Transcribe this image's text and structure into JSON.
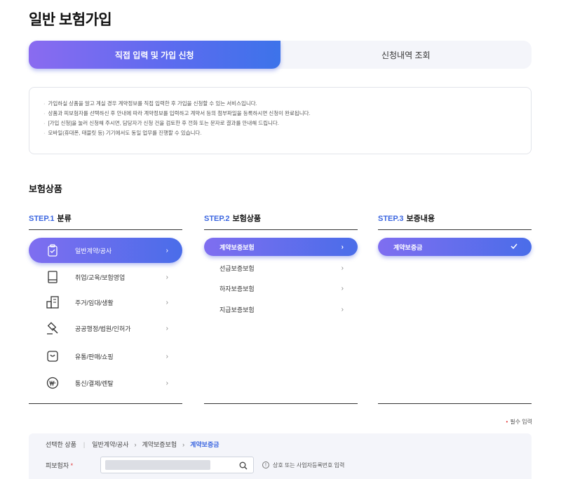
{
  "page": {
    "title": "일반 보험가입"
  },
  "tabs": [
    {
      "label": "직접 입력 및 가입 신청"
    },
    {
      "label": "신청내역 조회"
    }
  ],
  "notice": {
    "lines": [
      "가입하실 상품을 알고 계실 경우 계약정보를 직접 입력한 후 가입을 신청할 수 있는 서비스입니다.",
      "상품과 피보험자를 선택하신 후 안내에 따라 계약정보를 입력하고 계약서 등의 첨부파일을 등록하시면 신청이 완료됩니다.",
      "[가입 신청]을 눌러 신청해 주시면, 담당자가 신청 건을 검토한 후 전화 또는 문자로 결과를 안내해 드립니다.",
      "모바일(휴대폰, 태블릿 등) 기기에서도 동일 업무를 진행할 수 있습니다."
    ]
  },
  "products_section": {
    "title": "보험상품"
  },
  "step1": {
    "num": "STEP.1",
    "title": "분류",
    "items": [
      {
        "label": "일반계약/공사",
        "icon": "clipboard-icon"
      },
      {
        "label": "취업/교육/보험영업",
        "icon": "book-icon"
      },
      {
        "label": "주거/임대/생활",
        "icon": "building-icon"
      },
      {
        "label": "공공행정/법원/인허가",
        "icon": "gavel-icon"
      },
      {
        "label": "유통/판매/쇼핑",
        "icon": "shopping-bag-icon"
      },
      {
        "label": "통신/결제/렌탈",
        "icon": "won-coin-icon"
      }
    ]
  },
  "step2": {
    "num": "STEP.2",
    "title": "보험상품",
    "items": [
      {
        "label": "계약보증보험"
      },
      {
        "label": "선급보증보험"
      },
      {
        "label": "하자보증보험"
      },
      {
        "label": "지급보증보험"
      }
    ]
  },
  "step3": {
    "num": "STEP.3",
    "title": "보증내용",
    "items": [
      {
        "label": "계약보증금"
      }
    ]
  },
  "required": {
    "star": "•",
    "label": "필수 입력"
  },
  "summary": {
    "selected_label": "선택한 상품",
    "path": [
      "일반계약/공사",
      "계약보증보험",
      "계약보증금"
    ],
    "insured_label": "피보험자",
    "insured_star": "*",
    "hint": "상호 또는 사업자등록번호 입력"
  },
  "colors": {
    "accent": "#3b66e0",
    "gradient_start": "#8a6bf0",
    "gradient_end": "#3d73ea",
    "required": "#e23a3a"
  }
}
